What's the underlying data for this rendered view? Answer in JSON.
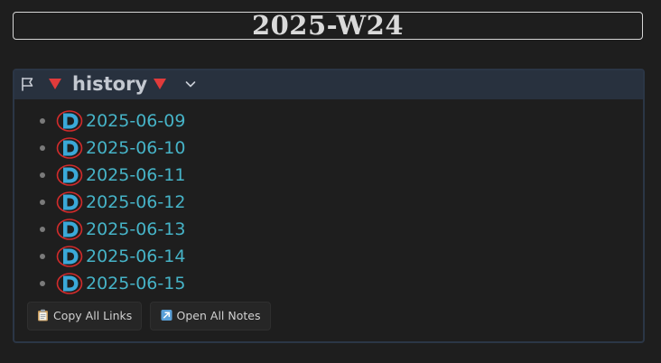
{
  "page": {
    "title": "2025-W24"
  },
  "callout": {
    "title": "history",
    "icons": {
      "header": "flag-icon",
      "marker": "red-triangle-icon",
      "toggle": "chevron-down-icon",
      "item": "daily-note-d-icon"
    },
    "items": [
      {
        "label": "2025-06-09"
      },
      {
        "label": "2025-06-10"
      },
      {
        "label": "2025-06-11"
      },
      {
        "label": "2025-06-12"
      },
      {
        "label": "2025-06-13"
      },
      {
        "label": "2025-06-14"
      },
      {
        "label": "2025-06-15"
      }
    ]
  },
  "buttons": {
    "copy_links": {
      "label": "Copy All Links",
      "icon": "clipboard-icon"
    },
    "open_notes": {
      "label": "Open All Notes",
      "icon": "arrow-up-right-icon"
    }
  },
  "colors": {
    "background": "#1e1e1e",
    "header_bg": "#28313e",
    "link": "#46b3c7",
    "marker": "#e03b3b",
    "d_icon_fill": "#3aa9d8",
    "d_icon_ring": "#d12b2b"
  }
}
